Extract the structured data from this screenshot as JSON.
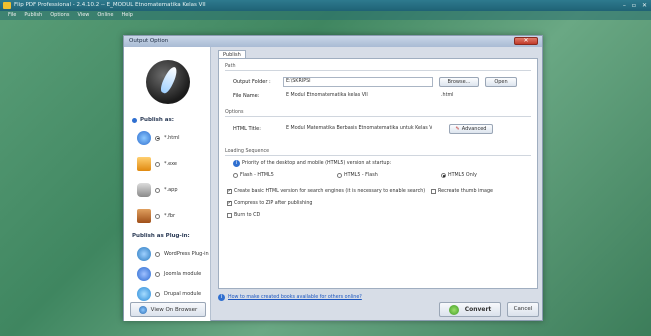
{
  "app": {
    "title": "Flip PDF Professional - 2.4.10.2 -- E_MODUL Etnomatematika Kelas VII",
    "menu": [
      "File",
      "Publish",
      "Options",
      "View",
      "Online",
      "Help"
    ],
    "window_controls": [
      "–",
      "▫",
      "✕"
    ]
  },
  "dialog": {
    "title": "Output Option",
    "close_label": "✕",
    "publish_as_header": "Publish as:",
    "publish_as_options": [
      {
        "label": "*.html",
        "selected": true,
        "icon": "html-globe-icon",
        "color": "#2f6fd0"
      },
      {
        "label": "*.exe",
        "selected": false,
        "icon": "exe-box-icon",
        "color": "#f0a020"
      },
      {
        "label": "*.app",
        "selected": false,
        "icon": "mac-app-icon",
        "color": "#8a8a8a"
      },
      {
        "label": "*.fbr",
        "selected": false,
        "icon": "fbr-book-icon",
        "color": "#c06a20"
      }
    ],
    "plugin_header": "Publish as Plug-in:",
    "plugin_options": [
      {
        "label": "WordPress Plug-in",
        "selected": false,
        "icon": "wordpress-icon",
        "color": "#2a7ac0"
      },
      {
        "label": "Joomla module",
        "selected": false,
        "icon": "joomla-icon",
        "color": "#2a6ad0"
      },
      {
        "label": "Drupal module",
        "selected": false,
        "icon": "drupal-icon",
        "color": "#2a8ad8"
      }
    ],
    "view_in_browser": "View On Browser",
    "tab_publish": "Publish",
    "path": {
      "title": "Path",
      "output_folder_label": "Output Folder :",
      "output_folder_value": "E:\\SKRIPSI",
      "browse_label": "Browse...",
      "open_label": "Open",
      "file_name_label": "File Name:",
      "file_name_value": "E Modul Etnomatematika kelas VII",
      "file_ext": ".html"
    },
    "options": {
      "title": "Options",
      "html_title_label": "HTML Title:",
      "html_title_value": "E Modul Matematika Berbasis Etnomatematika untuk Kelas VII P",
      "advanced_label": "Advanced"
    },
    "loading": {
      "title": "Loading Sequence",
      "priority_text": "Priority of the desktop and mobile (HTML5) version at startup:",
      "choices": [
        {
          "label": "Flash - HTML5",
          "selected": false
        },
        {
          "label": "HTML5 - Flash",
          "selected": false
        },
        {
          "label": "HTML5 Only",
          "selected": true
        }
      ]
    },
    "checks": [
      {
        "label": "Create basic HTML version for search engines (it is necessary to enable search)",
        "checked": true
      },
      {
        "label": "Recreate thumb image",
        "checked": false
      },
      {
        "label": "Compress to ZIP after publishing",
        "checked": true
      },
      {
        "label": "Burn to CD",
        "checked": false
      }
    ],
    "info_link": "How to make created books available for others online?",
    "convert_label": "Convert",
    "cancel_label": "Cancel"
  }
}
